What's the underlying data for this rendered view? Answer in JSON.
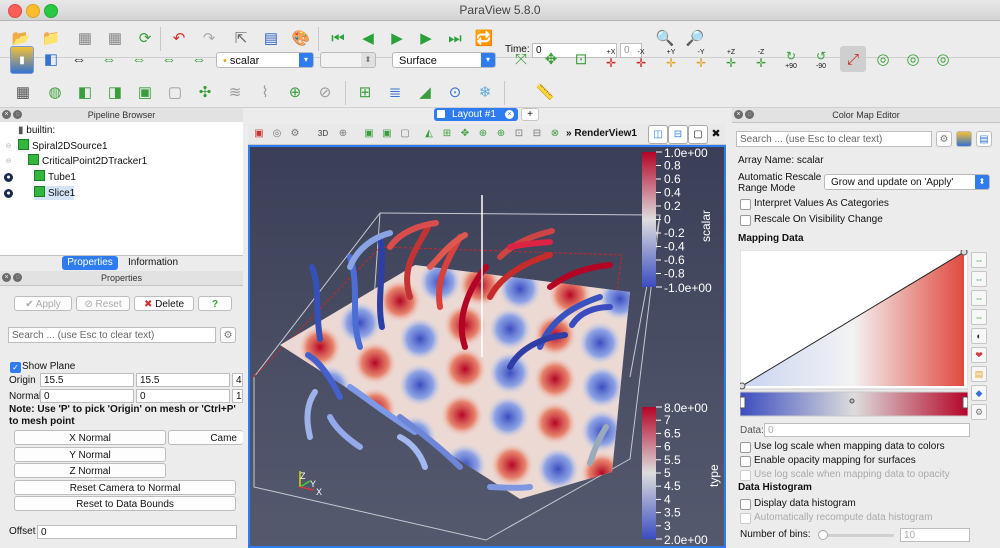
{
  "window": {
    "title": "ParaView 5.8.0"
  },
  "toolbar": {
    "time_label": "Time:",
    "time_value": "0",
    "time_index": "0",
    "color_by": "scalar",
    "component": "",
    "representation": "Surface",
    "camera_labels": [
      "+X",
      "-X",
      "+Y",
      "-Y",
      "+Z",
      "-Z",
      "+90",
      "-90"
    ]
  },
  "pipeline": {
    "title": "Pipeline Browser",
    "items": [
      {
        "label": "builtin:"
      },
      {
        "label": "Spiral2DSource1"
      },
      {
        "label": "CriticalPoint2DTracker1"
      },
      {
        "label": "Tube1"
      },
      {
        "label": "Slice1"
      }
    ]
  },
  "tabs": {
    "properties": "Properties",
    "information": "Information"
  },
  "properties": {
    "title": "Properties",
    "apply": "Apply",
    "reset": "Reset",
    "delete": "Delete",
    "help": "?",
    "search_placeholder": "Search ... (use Esc to clear text)",
    "show_plane": "Show Plane",
    "origin_label": "Origin",
    "origin": [
      "15.5",
      "15.5",
      "4"
    ],
    "normal_label": "Normal",
    "normal": [
      "0",
      "0",
      "1"
    ],
    "note": "Note: Use 'P' to pick 'Origin' on mesh or 'Ctrl+P' to mesh point",
    "x_normal": "X Normal",
    "camera_normal": "Came",
    "y_normal": "Y Normal",
    "z_normal": "Z Normal",
    "reset_camera": "Reset Camera to Normal",
    "reset_bounds": "Reset to Data Bounds",
    "offset_label": "Offset",
    "offset": "0"
  },
  "layout": {
    "tab": "Layout #1",
    "add": "+",
    "view_name": "RenderView1",
    "mode_3d": "3D"
  },
  "legend_scalar": {
    "title": "scalar",
    "max": "1.0e+00",
    "min": "-1.0e+00",
    "ticks": [
      "0.8",
      "0.6",
      "0.4",
      "0.2",
      "0",
      "-0.2",
      "-0.4",
      "-0.6",
      "-0.8"
    ]
  },
  "legend_type": {
    "title": "type",
    "max": "8.0e+00",
    "min": "2.0e+00",
    "ticks": [
      "7",
      "6.5",
      "6",
      "5.5",
      "5",
      "4.5",
      "4",
      "3.5",
      "3"
    ]
  },
  "axes": {
    "z": "Z",
    "y": "Y",
    "x": "X"
  },
  "colormap": {
    "title": "Color Map Editor",
    "search_placeholder": "Search ... (use Esc to clear text)",
    "array_name": "Array Name: scalar",
    "auto_rescale_label": "Automatic Rescale Range Mode",
    "auto_rescale_value": "Grow and update on 'Apply'",
    "interpret_categories": "Interpret Values As Categories",
    "rescale_visibility": "Rescale On Visibility Change",
    "mapping_data": "Mapping Data",
    "data_label": "Data:",
    "data_value": "0",
    "log_scale": "Use log scale when mapping data to colors",
    "opacity_mapping": "Enable opacity mapping for surfaces",
    "log_opacity": "Use log scale when mapping data to opacity",
    "data_histogram": "Data Histogram",
    "display_histogram": "Display data histogram",
    "auto_recompute": "Automatically recompute data histogram",
    "bins_label": "Number of bins:",
    "bins_value": "10"
  },
  "colors": {
    "accent": "#2f7bf0",
    "cool": "#3b4cc0",
    "warm": "#b40426"
  }
}
